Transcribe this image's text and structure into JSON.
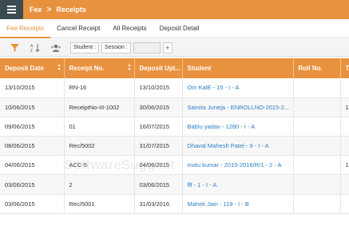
{
  "header": {
    "app": "Fee",
    "separator": ">",
    "page": "Receipts"
  },
  "tabs": [
    {
      "label": "Fee Receipts",
      "active": true
    },
    {
      "label": "Cancel Receipt",
      "active": false
    },
    {
      "label": "All Receipts",
      "active": false
    },
    {
      "label": "Deposit Detail",
      "active": false
    }
  ],
  "toolbar": {
    "icons": [
      "filter-icon",
      "sort-az-icon",
      "users-icon"
    ],
    "student_chip": "Student :",
    "session_chip": "Session :",
    "add_label": "+"
  },
  "table": {
    "columns": [
      "Deposit Date",
      "Receipt No.",
      "Deposit Upt...",
      "Student",
      "Roll No.",
      "To"
    ],
    "rows": [
      [
        "13/10/2015",
        "RN-16",
        "13/10/2015",
        "Om KalE - 15 - I - A",
        "",
        ""
      ],
      [
        "10/06/2015",
        "ReceiptNo-III-1002",
        "30/06/2015",
        "Samita Juneja - ENROLLNO-2015-2...",
        "",
        "1"
      ],
      [
        "09/06/2015",
        "01",
        "16/07/2015",
        "Bablu yadav - 1280 - I - A",
        "",
        ""
      ],
      [
        "08/06/2015",
        "Rec/5002",
        "31/07/2015",
        "Dhaval Mahesh Patel - 9 - I - A",
        "",
        ""
      ],
      [
        "04/06/2015",
        "ACC-5",
        "04/06/2015",
        "motu kumar - 2015-2016/R/1 - 2 - A",
        "",
        "1"
      ],
      [
        "03/06/2015",
        "2",
        "03/06/2015",
        "fff - 1 - I - A",
        "",
        ""
      ],
      [
        "03/06/2015",
        "Rec/5001",
        "31/03/2016",
        "Mahek Jain - 119 - I - B",
        "",
        ""
      ]
    ]
  },
  "colors": {
    "accent": "#e8923f",
    "menu_bg": "#3c4a52",
    "link": "#2a7fc9"
  }
}
